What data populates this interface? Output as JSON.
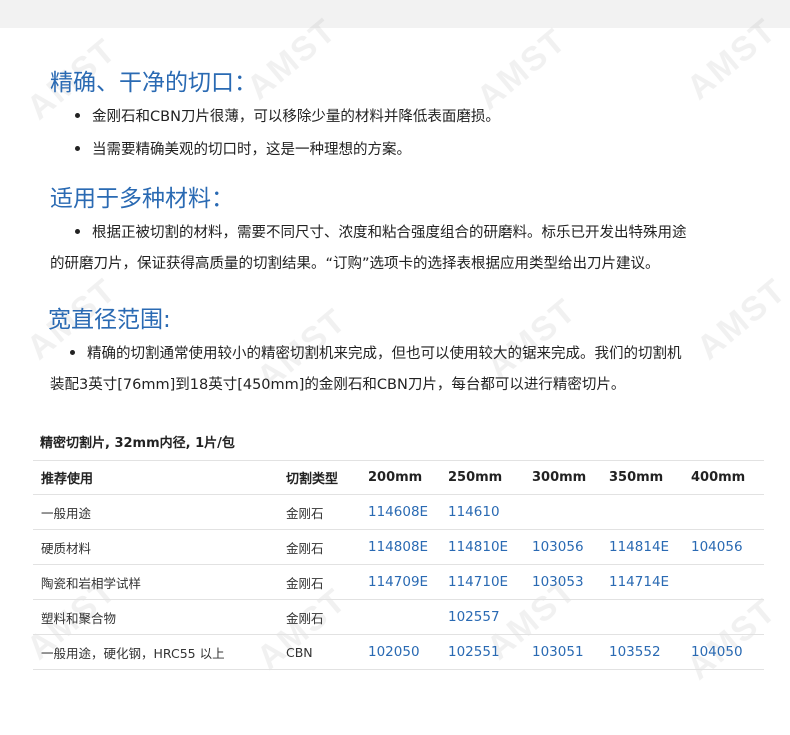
{
  "sections": [
    {
      "heading": "精确、干净的切口：",
      "bullets": [
        "金刚石和CBN刀片很薄，可以移除少量的材料并降低表面磨损。",
        "当需要精确美观的切口时，这是一种理想的方案。"
      ]
    },
    {
      "heading": "适用于多种材料：",
      "para_line1": "根据正被切割的材料，需要不同尺寸、浓度和粘合强度组合的研磨料。标乐已开发出特殊用途",
      "para_line2": "的研磨刀片，保证获得高质量的切割结果。“订购”选项卡的选择表根据应用类型给出刀片建议。"
    },
    {
      "heading": "宽直径范围:",
      "para_line1": "精确的切割通常使用较小的精密切割机来完成，但也可以使用较大的锯来完成。我们的切割机",
      "para_line2": "装配3英寸[76mm]到18英寸[450mm]的金刚石和CBN刀片，每台都可以进行精密切片。"
    }
  ],
  "table": {
    "caption": "精密切割片, 32mm内径, 1片/包",
    "headers": [
      "推荐使用",
      "切割类型",
      "200mm",
      "250mm",
      "300mm",
      "350mm",
      "400mm"
    ],
    "rows": [
      [
        "一般用途",
        "金刚石",
        "114608E",
        "114610",
        "",
        "",
        ""
      ],
      [
        "硬质材料",
        "金刚石",
        "114808E",
        "114810E",
        "103056",
        "114814E",
        "104056"
      ],
      [
        "陶瓷和岩相学试样",
        "金刚石",
        "114709E",
        "114710E",
        "103053",
        "114714E",
        ""
      ],
      [
        "塑料和聚合物",
        "金刚石",
        "",
        "102557",
        "",
        "",
        ""
      ],
      [
        "一般用途，硬化钢，HRC55 以上",
        "CBN",
        "102050",
        "102551",
        "103051",
        "103552",
        "104050"
      ]
    ]
  },
  "watermark": "AMST",
  "colors": {
    "heading": "#2a6ab3",
    "link": "#2a6ab3"
  }
}
